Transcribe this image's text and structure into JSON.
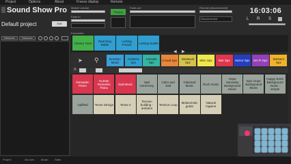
{
  "menu": {
    "items": [
      "Project",
      "Options",
      "About",
      "Freeze display",
      "Remote"
    ]
  },
  "app": {
    "title": "Sound Show Pro",
    "project_name": "Default project",
    "edit_label": "Edit"
  },
  "sidebar": {
    "btn1": "Discover",
    "btn2": "Discover"
  },
  "controls": {
    "master_label": "Master volume",
    "fade_label": "Fade-in",
    "fadeout_label": "Fade-out",
    "playing_label": "Playing",
    "remote_label": "Remote (disconnected)",
    "remote_value": "Disconnected"
  },
  "clock": {
    "time": "16:03:06"
  },
  "meters": {
    "l": "L",
    "r": "R",
    "s": "S",
    "solo": "Solo"
  },
  "fav_label": "Favourites",
  "favourites": [
    {
      "label": "Cheery Tune",
      "color": "#43b04a",
      "text": "dark"
    },
    {
      "label": "Reaching Battle",
      "color": "#2f9fd0",
      "text": "dark"
    },
    {
      "label": "Lurking Pursuit",
      "color": "#2f9fd0",
      "text": "dark"
    },
    {
      "label": "Lurking Subtle",
      "color": "#2f9fd0",
      "text": "dark"
    }
  ],
  "categories": [
    {
      "label": "Emotion Music",
      "color": "#3aa0d8",
      "text": "dark"
    },
    {
      "label": "Ambient Spx",
      "color": "#2f9fd0",
      "text": "dark"
    },
    {
      "label": "Animals Spx",
      "color": "#35b5a3",
      "text": "dark"
    },
    {
      "label": "Crowd Spx",
      "color": "#e8873a",
      "text": "dark"
    },
    {
      "label": "Medieval Spx",
      "color": "#d7c24a",
      "text": "dark"
    },
    {
      "label": "Misc Spx",
      "color": "#f0e84a",
      "text": "dark"
    },
    {
      "label": "War Spx",
      "color": "#e0364e",
      "text": "light"
    },
    {
      "label": "Horror Spx",
      "color": "#253dbf",
      "text": "light"
    },
    {
      "label": "Sci-Fi Spx",
      "color": "#9440b8",
      "text": "light"
    },
    {
      "label": "Western Spx",
      "color": "#f1b22c",
      "text": "dark"
    }
  ],
  "sounds_row1": [
    {
      "label": "Romantic Piano",
      "color": "#d8374f",
      "text": "light"
    },
    {
      "label": "Human Romantic Piano",
      "color": "#d8374f",
      "text": "light"
    },
    {
      "label": "Sad Music",
      "color": "#d8374f",
      "text": "light"
    },
    {
      "label": "Sad Ceremony",
      "color": "#9aa39c",
      "text": "dark"
    },
    {
      "label": "Calm and Sad",
      "color": "#9aa39c",
      "text": "dark"
    },
    {
      "label": "Classical Music",
      "color": "#9aa39c",
      "text": "dark"
    },
    {
      "label": "Rock music",
      "color": "#9aa39c",
      "text": "dark"
    },
    {
      "label": "Hope Humanity Background Music",
      "color": "#9aa39c",
      "text": "dark"
    },
    {
      "label": "Epic Hope Background Music",
      "color": "#9aa39c",
      "text": "dark"
    },
    {
      "label": "Happy Eerie Background music - simple",
      "color": "#9aa39c",
      "text": "dark"
    }
  ],
  "sounds_row2": [
    {
      "label": "Uplifted",
      "color": "#9aa39c",
      "text": "dark"
    },
    {
      "label": "Tense Strings",
      "color": "#d6cfb8",
      "text": "dark"
    },
    {
      "label": "Tense 2",
      "color": "#d6cfb8",
      "text": "dark"
    },
    {
      "label": "Tension building - ambient",
      "color": "#d6cfb8",
      "text": "dark"
    },
    {
      "label": "Tension Loop",
      "color": "#d6cfb8",
      "text": "dark"
    },
    {
      "label": "Melancholic guitar",
      "color": "#d6cfb8",
      "text": "dark"
    },
    {
      "label": "Natural Ingame",
      "color": "#d6cfb8",
      "text": "dark"
    }
  ],
  "status": {
    "left": "Project",
    "mid1": "All cues",
    "mid2": "Music",
    "mid3": "Stats"
  },
  "device": {
    "pad_color": "#7fb6d3"
  }
}
